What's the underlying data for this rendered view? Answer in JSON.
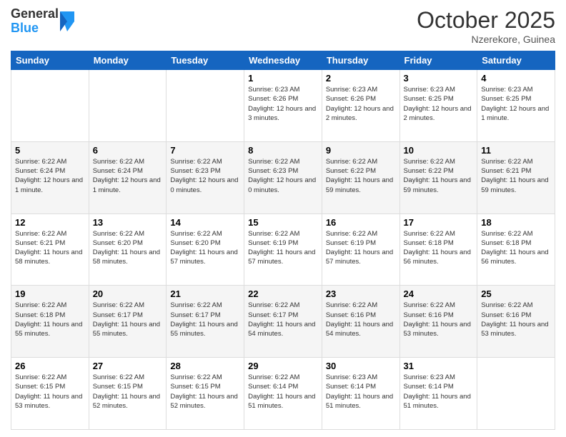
{
  "header": {
    "logo_general": "General",
    "logo_blue": "Blue",
    "month": "October 2025",
    "location": "Nzerekore, Guinea"
  },
  "days_of_week": [
    "Sunday",
    "Monday",
    "Tuesday",
    "Wednesday",
    "Thursday",
    "Friday",
    "Saturday"
  ],
  "weeks": [
    [
      {
        "day": "",
        "info": ""
      },
      {
        "day": "",
        "info": ""
      },
      {
        "day": "",
        "info": ""
      },
      {
        "day": "1",
        "info": "Sunrise: 6:23 AM\nSunset: 6:26 PM\nDaylight: 12 hours and 3 minutes."
      },
      {
        "day": "2",
        "info": "Sunrise: 6:23 AM\nSunset: 6:26 PM\nDaylight: 12 hours and 2 minutes."
      },
      {
        "day": "3",
        "info": "Sunrise: 6:23 AM\nSunset: 6:25 PM\nDaylight: 12 hours and 2 minutes."
      },
      {
        "day": "4",
        "info": "Sunrise: 6:23 AM\nSunset: 6:25 PM\nDaylight: 12 hours and 1 minute."
      }
    ],
    [
      {
        "day": "5",
        "info": "Sunrise: 6:22 AM\nSunset: 6:24 PM\nDaylight: 12 hours and 1 minute."
      },
      {
        "day": "6",
        "info": "Sunrise: 6:22 AM\nSunset: 6:24 PM\nDaylight: 12 hours and 1 minute."
      },
      {
        "day": "7",
        "info": "Sunrise: 6:22 AM\nSunset: 6:23 PM\nDaylight: 12 hours and 0 minutes."
      },
      {
        "day": "8",
        "info": "Sunrise: 6:22 AM\nSunset: 6:23 PM\nDaylight: 12 hours and 0 minutes."
      },
      {
        "day": "9",
        "info": "Sunrise: 6:22 AM\nSunset: 6:22 PM\nDaylight: 11 hours and 59 minutes."
      },
      {
        "day": "10",
        "info": "Sunrise: 6:22 AM\nSunset: 6:22 PM\nDaylight: 11 hours and 59 minutes."
      },
      {
        "day": "11",
        "info": "Sunrise: 6:22 AM\nSunset: 6:21 PM\nDaylight: 11 hours and 59 minutes."
      }
    ],
    [
      {
        "day": "12",
        "info": "Sunrise: 6:22 AM\nSunset: 6:21 PM\nDaylight: 11 hours and 58 minutes."
      },
      {
        "day": "13",
        "info": "Sunrise: 6:22 AM\nSunset: 6:20 PM\nDaylight: 11 hours and 58 minutes."
      },
      {
        "day": "14",
        "info": "Sunrise: 6:22 AM\nSunset: 6:20 PM\nDaylight: 11 hours and 57 minutes."
      },
      {
        "day": "15",
        "info": "Sunrise: 6:22 AM\nSunset: 6:19 PM\nDaylight: 11 hours and 57 minutes."
      },
      {
        "day": "16",
        "info": "Sunrise: 6:22 AM\nSunset: 6:19 PM\nDaylight: 11 hours and 57 minutes."
      },
      {
        "day": "17",
        "info": "Sunrise: 6:22 AM\nSunset: 6:18 PM\nDaylight: 11 hours and 56 minutes."
      },
      {
        "day": "18",
        "info": "Sunrise: 6:22 AM\nSunset: 6:18 PM\nDaylight: 11 hours and 56 minutes."
      }
    ],
    [
      {
        "day": "19",
        "info": "Sunrise: 6:22 AM\nSunset: 6:18 PM\nDaylight: 11 hours and 55 minutes."
      },
      {
        "day": "20",
        "info": "Sunrise: 6:22 AM\nSunset: 6:17 PM\nDaylight: 11 hours and 55 minutes."
      },
      {
        "day": "21",
        "info": "Sunrise: 6:22 AM\nSunset: 6:17 PM\nDaylight: 11 hours and 55 minutes."
      },
      {
        "day": "22",
        "info": "Sunrise: 6:22 AM\nSunset: 6:17 PM\nDaylight: 11 hours and 54 minutes."
      },
      {
        "day": "23",
        "info": "Sunrise: 6:22 AM\nSunset: 6:16 PM\nDaylight: 11 hours and 54 minutes."
      },
      {
        "day": "24",
        "info": "Sunrise: 6:22 AM\nSunset: 6:16 PM\nDaylight: 11 hours and 53 minutes."
      },
      {
        "day": "25",
        "info": "Sunrise: 6:22 AM\nSunset: 6:16 PM\nDaylight: 11 hours and 53 minutes."
      }
    ],
    [
      {
        "day": "26",
        "info": "Sunrise: 6:22 AM\nSunset: 6:15 PM\nDaylight: 11 hours and 53 minutes."
      },
      {
        "day": "27",
        "info": "Sunrise: 6:22 AM\nSunset: 6:15 PM\nDaylight: 11 hours and 52 minutes."
      },
      {
        "day": "28",
        "info": "Sunrise: 6:22 AM\nSunset: 6:15 PM\nDaylight: 11 hours and 52 minutes."
      },
      {
        "day": "29",
        "info": "Sunrise: 6:22 AM\nSunset: 6:14 PM\nDaylight: 11 hours and 51 minutes."
      },
      {
        "day": "30",
        "info": "Sunrise: 6:23 AM\nSunset: 6:14 PM\nDaylight: 11 hours and 51 minutes."
      },
      {
        "day": "31",
        "info": "Sunrise: 6:23 AM\nSunset: 6:14 PM\nDaylight: 11 hours and 51 minutes."
      },
      {
        "day": "",
        "info": ""
      }
    ]
  ]
}
